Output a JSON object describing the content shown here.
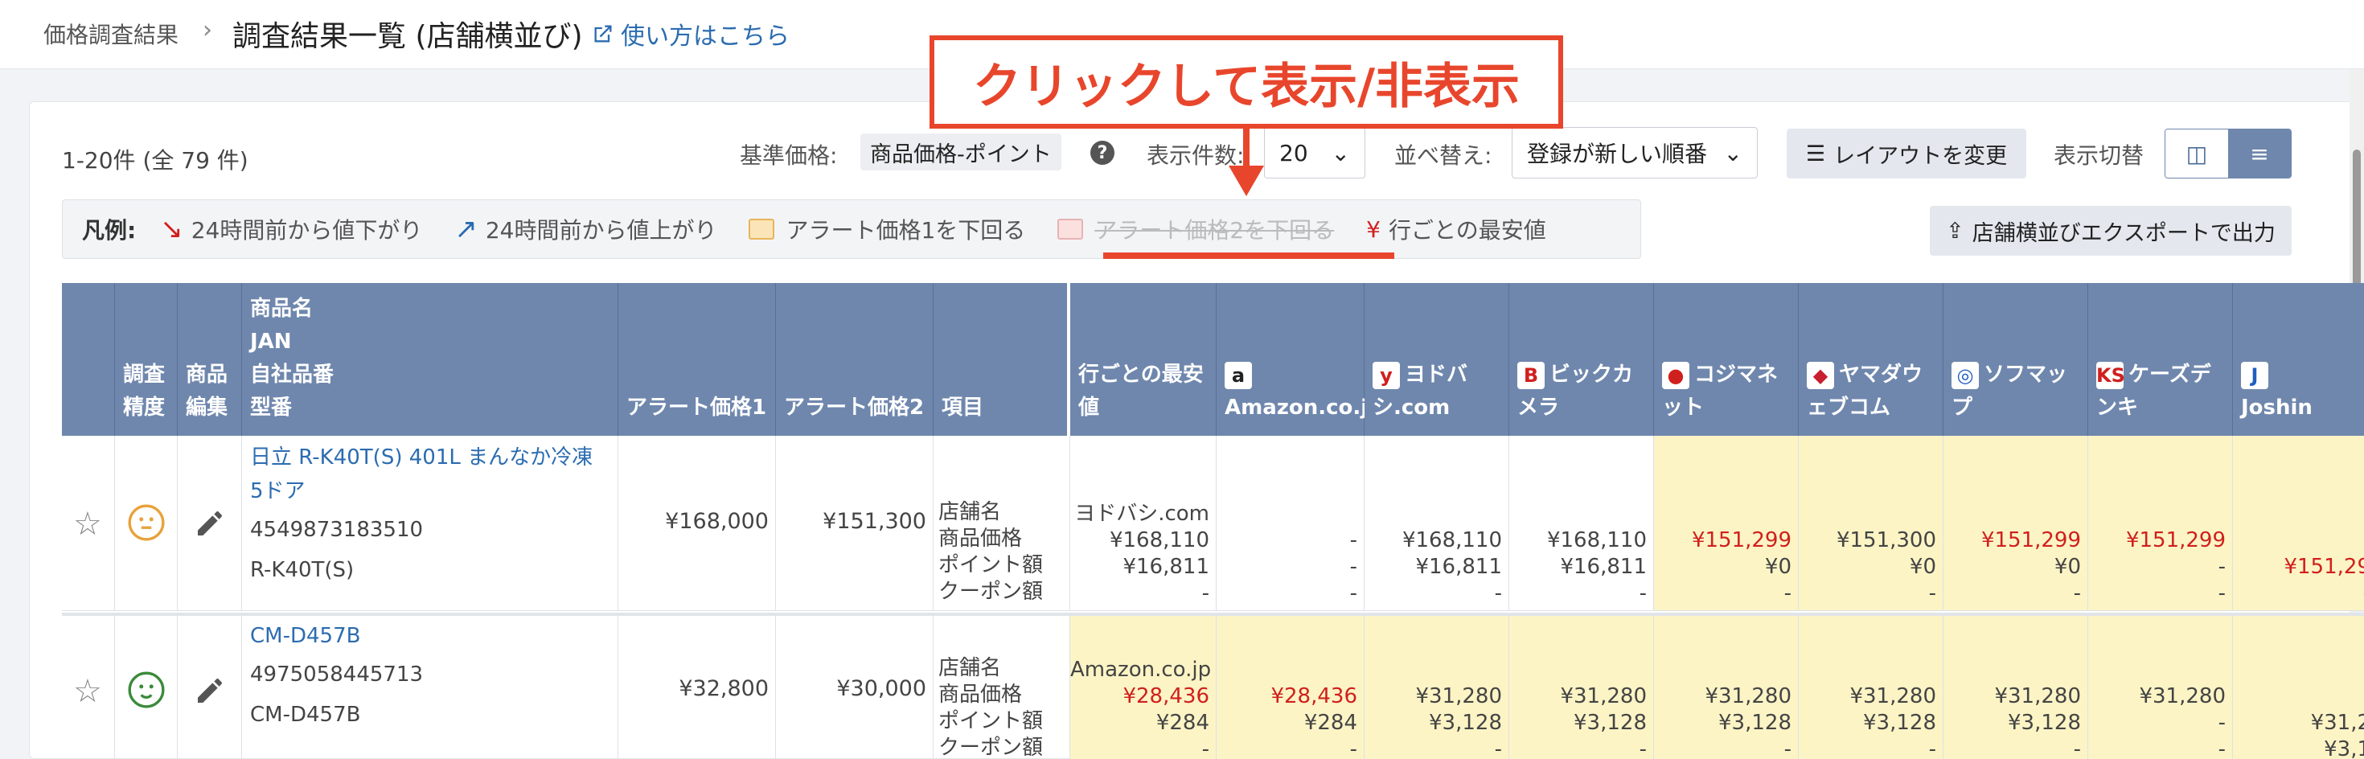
{
  "breadcrumb": {
    "parent": "価格調査結果",
    "separator": "›",
    "current": "調査結果一覧 (店舗横並び)",
    "help": "使い方はこちら"
  },
  "callout": "クリックして表示/非表示",
  "toolbar": {
    "count": "1-20件 (全 79 件)",
    "base_price_label": "基準価格:",
    "base_price_value": "商品価格-ポイント",
    "per_page_label": "表示件数:",
    "per_page_value": "20",
    "sort_label": "並べ替え:",
    "sort_value": "登録が新しい順番",
    "layout_button": "レイアウトを変更",
    "view_toggle_label": "表示切替",
    "export_button": "店舗横並びエクスポートで出力"
  },
  "legend": {
    "title": "凡例:",
    "items": [
      {
        "icon": "↘",
        "label": "24時間前から値下がり",
        "color": "#d0201e"
      },
      {
        "icon": "↗",
        "label": "24時間前から値上がり",
        "color": "#2b6cb0"
      },
      {
        "label": "アラート価格1を下回る",
        "swatch": "#fbe5b8",
        "border": "#e7b55c"
      },
      {
        "label": "アラート価格2を下回る",
        "swatch": "#fbe0e0",
        "border": "#e8b3b3"
      },
      {
        "icon": "¥",
        "label": "行ごとの最安値",
        "color": "#d0201e"
      }
    ]
  },
  "table": {
    "headers": {
      "accuracy": [
        "調査",
        "精度"
      ],
      "edit": [
        "商品",
        "編集"
      ],
      "product": [
        "商品名",
        "JAN",
        "自社品番",
        "型番"
      ],
      "alert1": "アラート価格1",
      "alert2": "アラート価格2",
      "item": "項目",
      "lowest": [
        "行ごとの最安",
        "値"
      ]
    },
    "stores": [
      {
        "name": [
          "",
          "Amazon.co.jp"
        ],
        "icon": "a",
        "icon_color": "#222"
      },
      {
        "name": [
          "ヨドバ",
          "シ.com"
        ],
        "icon": "y",
        "icon_color": "#d0201e"
      },
      {
        "name": [
          "ビックカ",
          "メラ"
        ],
        "icon": "B",
        "icon_color": "#d0201e"
      },
      {
        "name": [
          "コジマネ",
          "ット"
        ],
        "icon": "●",
        "icon_color": "#d0201e"
      },
      {
        "name": [
          "ヤマダウ",
          "ェブコム"
        ],
        "icon": "◆",
        "icon_color": "#c8202e"
      },
      {
        "name": [
          "ソフマッ",
          "プ"
        ],
        "icon": "◎",
        "icon_color": "#1f5fbf"
      },
      {
        "name": [
          "ケーズデ",
          "ンキ"
        ],
        "icon": "KS",
        "icon_color": "#d0201e"
      },
      {
        "name": [
          "",
          "Joshin"
        ],
        "icon": "J",
        "icon_color": "#1f5fbf"
      }
    ],
    "row_labels": [
      "店舗名",
      "商品価格",
      "ポイント額",
      "クーポン額"
    ],
    "rows": [
      {
        "name": [
          "日立 R-K40T(S) 401L まんなか冷凍",
          "5ドア"
        ],
        "jan": "4549873183510",
        "model": "R-K40T(S)",
        "face": "neutral",
        "alert1": "¥168,000",
        "alert2": "¥151,300",
        "lowest": [
          "ヨドバシ.com",
          "¥168,110",
          "¥16,811",
          "-"
        ],
        "stores": [
          [
            "-",
            "-",
            "-"
          ],
          [
            "¥168,110",
            "¥16,811",
            "-"
          ],
          [
            "¥168,110",
            "¥16,811",
            "-"
          ],
          [
            "¥151,299",
            "¥0",
            "-"
          ],
          [
            "¥151,300",
            "¥0",
            "-"
          ],
          [
            "¥151,299",
            "¥0",
            "-"
          ],
          [
            "¥151,299",
            "-",
            "-"
          ],
          [
            "¥151,29",
            "-",
            ""
          ]
        ],
        "store_red": [
          false,
          false,
          false,
          true,
          false,
          true,
          true,
          true
        ],
        "store_yellow": [
          false,
          false,
          false,
          true,
          true,
          true,
          true,
          true
        ]
      },
      {
        "name": [
          "CM-D457B",
          ""
        ],
        "jan": "4975058445713",
        "model": "CM-D457B",
        "face": "happy",
        "alert1": "¥32,800",
        "alert2": "¥30,000",
        "lowest": [
          "Amazon.co.jp",
          "¥28,436",
          "¥284",
          "-"
        ],
        "stores": [
          [
            "¥28,436",
            "¥284",
            "-"
          ],
          [
            "¥31,280",
            "¥3,128",
            "-"
          ],
          [
            "¥31,280",
            "¥3,128",
            "-"
          ],
          [
            "¥31,280",
            "¥3,128",
            "-"
          ],
          [
            "¥31,280",
            "¥3,128",
            "-"
          ],
          [
            "¥31,280",
            "¥3,128",
            "-"
          ],
          [
            "¥31,280",
            "-",
            "-"
          ],
          [
            "¥31,2",
            "¥3,1",
            ""
          ]
        ],
        "store_red": [
          true,
          false,
          false,
          false,
          false,
          false,
          false,
          false
        ],
        "store_yellow": [
          true,
          true,
          true,
          true,
          true,
          true,
          true,
          true
        ]
      }
    ]
  }
}
